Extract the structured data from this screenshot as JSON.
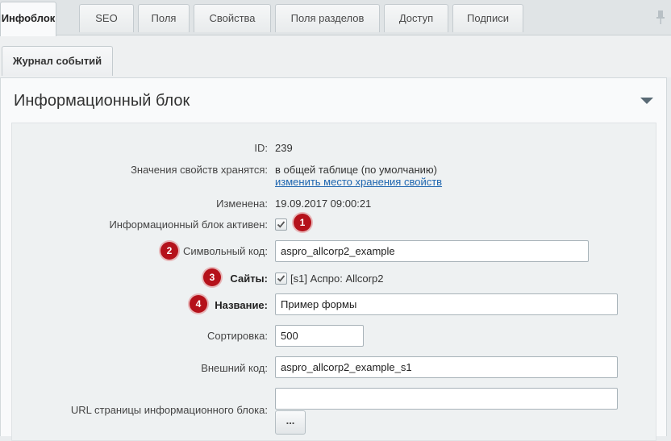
{
  "tabs": [
    {
      "label": "Инфоблок",
      "active": true
    },
    {
      "label": "SEO"
    },
    {
      "label": "Поля"
    },
    {
      "label": "Свойства"
    },
    {
      "label": "Поля разделов"
    },
    {
      "label": "Доступ"
    },
    {
      "label": "Подписи"
    }
  ],
  "tabs2": [
    {
      "label": "Журнал событий"
    }
  ],
  "panel": {
    "title": "Информационный блок"
  },
  "form": {
    "id_label": "ID:",
    "id_value": "239",
    "storage_label": "Значения свойств хранятся:",
    "storage_value": "в общей таблице (по умолчанию)",
    "storage_link": "изменить место хранения свойств",
    "modified_label": "Изменена:",
    "modified_value": "19.09.2017 09:00:21",
    "active_label": "Информационный блок активен:",
    "active_checked": true,
    "code_label": "Символьный код:",
    "code_value": "aspro_allcorp2_example",
    "sites_label": "Сайты:",
    "sites_value": "[s1] Аспро: Allcorp2",
    "sites_checked": true,
    "name_label": "Название:",
    "name_value": "Пример формы",
    "sort_label": "Сортировка:",
    "sort_value": "500",
    "xml_label": "Внешний код:",
    "xml_value": "aspro_allcorp2_example_s1",
    "url_label": "URL страницы информационного блока:",
    "url_value": "",
    "url_button": "..."
  },
  "badges": [
    "1",
    "2",
    "3",
    "4"
  ],
  "icons": {
    "pin": "pin-icon",
    "collapse": "triangle-down-icon",
    "check": "checkmark-icon"
  },
  "colors": {
    "badge": "#b5121b",
    "link": "#2067b0"
  }
}
